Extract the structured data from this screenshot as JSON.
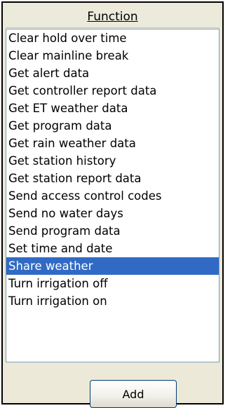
{
  "header": {
    "title": "Function"
  },
  "list": {
    "items": [
      "Clear hold over time",
      "Clear mainline break",
      "Get alert data",
      "Get controller report data",
      "Get ET weather data",
      "Get program data",
      "Get rain weather data",
      "Get station history",
      "Get station report data",
      "Send access control codes",
      "Send no water days",
      "Send program data",
      "Set time and date",
      "Share weather",
      "Turn irrigation off",
      "Turn irrigation on"
    ],
    "selected": "Share weather"
  },
  "footer": {
    "add_label": "Add"
  },
  "colors": {
    "selection": "#316ac5",
    "panel": "#ece9d8",
    "list_border": "#7f9db9"
  }
}
